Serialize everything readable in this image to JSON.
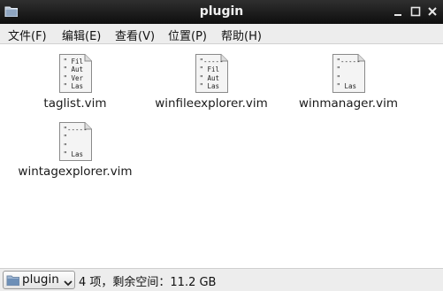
{
  "window": {
    "title": "plugin"
  },
  "menu": [
    {
      "label": "文件(F)"
    },
    {
      "label": "编辑(E)"
    },
    {
      "label": "查看(V)"
    },
    {
      "label": "位置(P)"
    },
    {
      "label": "帮助(H)"
    }
  ],
  "files": [
    {
      "name": "taglist.vim",
      "preview": [
        "\" Fil",
        "\" Aut",
        "\" Ver",
        "\" Las"
      ]
    },
    {
      "name": "winfileexplorer.vim",
      "preview": [
        "\"-----",
        "\" Fil",
        "\" Aut",
        "\" Las"
      ]
    },
    {
      "name": "winmanager.vim",
      "preview": [
        "\"-----",
        "\"",
        "\"",
        "\" Las"
      ]
    },
    {
      "name": "wintagexplorer.vim",
      "preview": [
        "\"-----",
        "\"",
        "\"",
        "\" Las"
      ]
    }
  ],
  "status": {
    "location": "plugin",
    "summary": "4 项，剩余空间：11.2 GB"
  },
  "icons": {
    "folder": "folder-icon",
    "file": "vim-script-file-icon",
    "dropdown": "chevron-down-icon"
  }
}
